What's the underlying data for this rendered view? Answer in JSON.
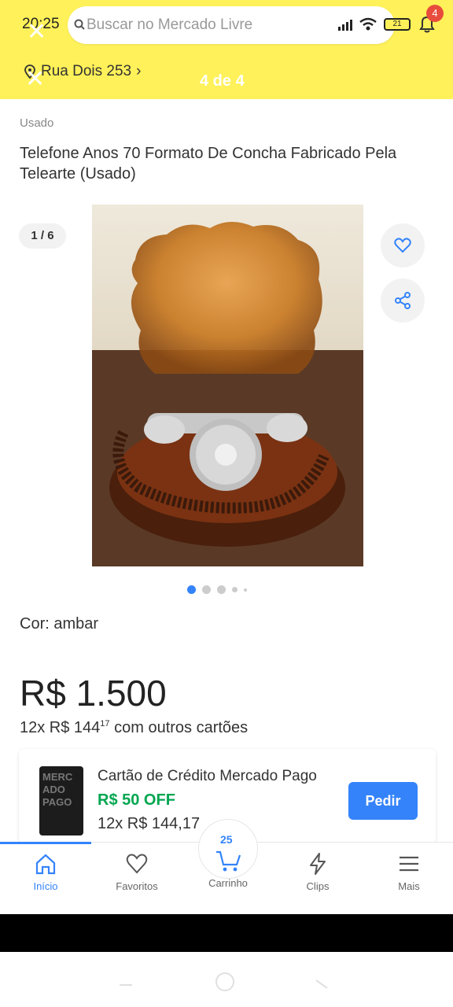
{
  "status": {
    "time": "20:25",
    "battery": "21"
  },
  "header": {
    "search_placeholder": "Buscar no Mercado Livre",
    "notifications_count": "4",
    "address": "Rua Dois 253",
    "image_counter": "4 de 4",
    "background_color": "#fff159"
  },
  "product": {
    "condition": "Usado",
    "title": "Telefone Anos 70  Formato De Concha Fabricado Pela Telearte (Usado)",
    "image_index": "1 / 6",
    "color_label": "Cor:",
    "color_value": "ambar",
    "price": "R$ 1.500",
    "installments_prefix": "12x R$ 144",
    "installments_cents": "17",
    "installments_suffix": " com outros cartões"
  },
  "offer": {
    "card_text": "MERCADO PAGO",
    "title": "Cartão de Crédito Mercado Pago",
    "discount": "R$ 50 OFF",
    "installments": "12x R$ 144,17",
    "button": "Pedir",
    "button_color": "#3483fa",
    "discount_color": "#00a650"
  },
  "nav": {
    "items": [
      {
        "label": "Início",
        "icon": "home-icon",
        "active": true
      },
      {
        "label": "Favoritos",
        "icon": "heart-icon"
      },
      {
        "label": "Carrinho",
        "icon": "cart-icon",
        "count": "25"
      },
      {
        "label": "Clips",
        "icon": "clips-icon"
      },
      {
        "label": "Mais",
        "icon": "menu-icon"
      }
    ]
  }
}
